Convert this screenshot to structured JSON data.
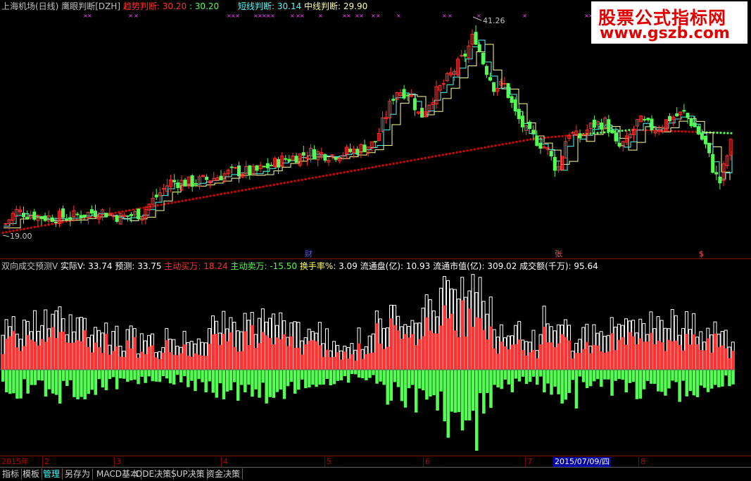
{
  "upper": {
    "title": "上海机场(日线)",
    "indicator_name": "鹰眼判断[DZH]",
    "trend_label": "趋势判断: 30.20",
    "trend_value2": ": 30.20",
    "short_label": "短线判断: 30.14",
    "mid_label": "中线判断: 29.90",
    "high_label": "41.26",
    "low_label": "19.00",
    "markers": [
      "财",
      "张",
      "$"
    ]
  },
  "lower": {
    "name": "双向成交预测V",
    "actual_label": "实际V",
    "actual_value": ": 33.74",
    "forecast_label": "预测",
    "forecast_value": ": 33.75",
    "buy_label": "主动买万",
    "buy_value": ": 18.24",
    "sell_label": "主动卖万",
    "sell_value": ": -15.50",
    "turnover_label": "换手率%",
    "turnover_value": ": 3.09",
    "float_label": "流通盘(亿)",
    "float_value": ": 10.93",
    "mcap_label": "流通市值(亿)",
    "mcap_value": ": 309.02",
    "amount_label": "成交额(千万)",
    "amount_value": ": 95.64"
  },
  "axis": {
    "year": "2015年",
    "months": [
      "2",
      "3",
      "4",
      "5",
      "6",
      "7",
      "8"
    ],
    "cursor_date": "2015/07/09/四"
  },
  "tabs": [
    "指标",
    "模板",
    "管理",
    "另存为",
    "MACD基本",
    "DDE决策",
    "SUP决策",
    "资金决策"
  ],
  "active_tab": "管理",
  "watermark": {
    "line1": "股票公式指标网",
    "line2": "www.gszb.com"
  },
  "colors": {
    "up": "#ff3232",
    "down": "#54fc54",
    "short_line": "#54fcfc",
    "mid_line": "#ffff9c",
    "trend_dots": "#e00000",
    "volume_outline": "#ffffff",
    "bg": "#000000"
  }
}
